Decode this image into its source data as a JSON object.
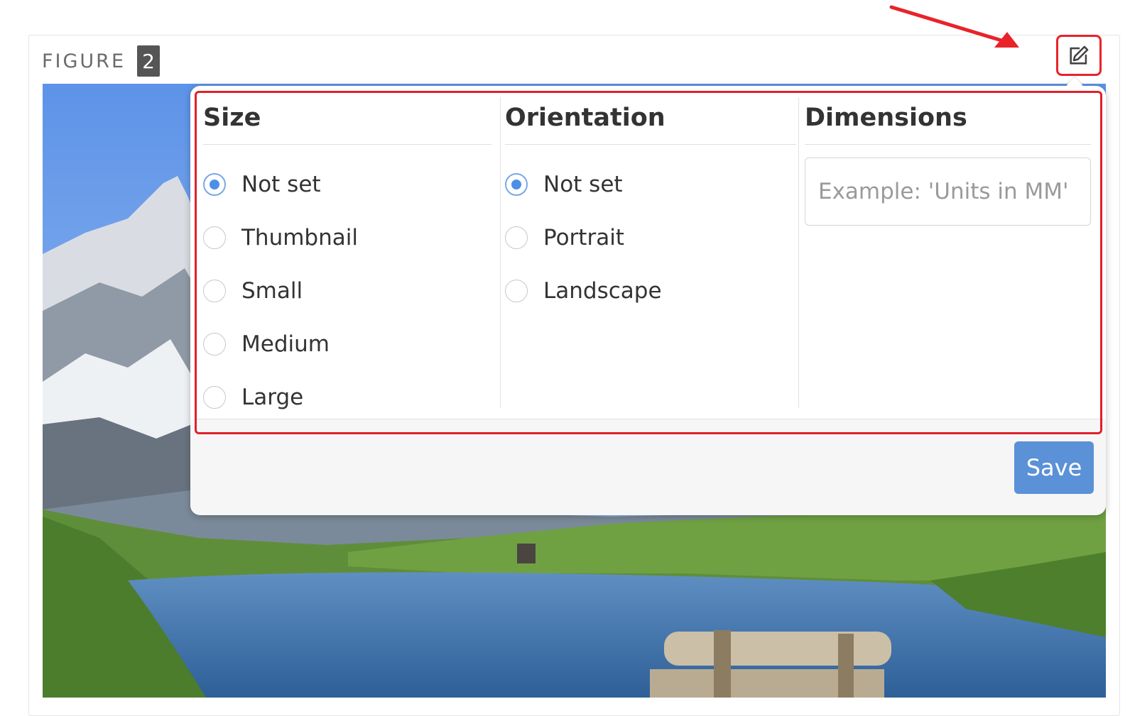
{
  "figure": {
    "label": "FIGURE",
    "number": "2"
  },
  "edit_button": {
    "icon": "pencil-square-icon"
  },
  "size": {
    "title": "Size",
    "options": [
      "Not set",
      "Thumbnail",
      "Small",
      "Medium",
      "Large"
    ],
    "selected": "Not set"
  },
  "orientation": {
    "title": "Orientation",
    "options": [
      "Not set",
      "Portrait",
      "Landscape"
    ],
    "selected": "Not set"
  },
  "dimensions": {
    "title": "Dimensions",
    "value": "",
    "placeholder": "Example: 'Units in MM'"
  },
  "save_label": "Save",
  "colors": {
    "accent": "#5b91d6",
    "highlight": "#e0212b"
  }
}
